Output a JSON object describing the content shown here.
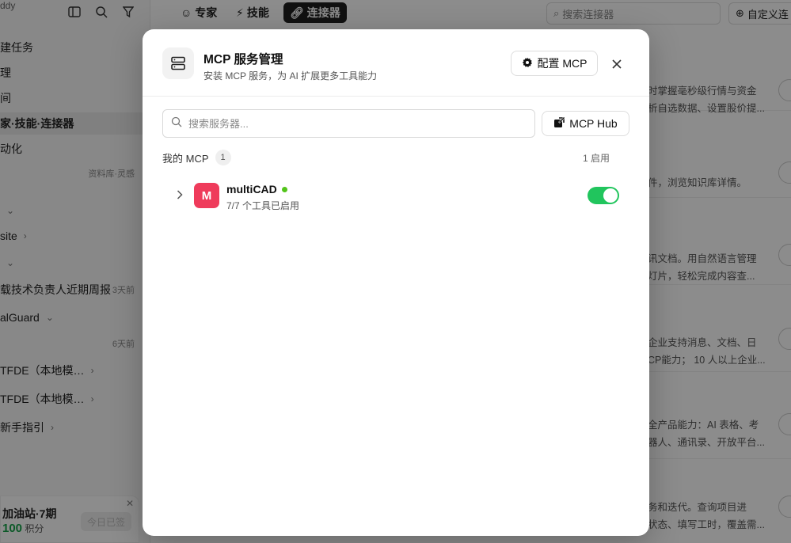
{
  "app": {
    "brand": "ddy",
    "sidebar": {
      "items": [
        {
          "label": "建任务",
          "meta": ""
        },
        {
          "label": "理",
          "meta": ""
        },
        {
          "label": "间",
          "meta": ""
        },
        {
          "label": "家·技能·连接器",
          "meta": ""
        },
        {
          "label": "动化",
          "meta": ""
        },
        {
          "label": "",
          "meta": "资料库·灵感"
        },
        {
          "label": "",
          "meta": ""
        },
        {
          "label": "site",
          "meta": ""
        },
        {
          "label": "",
          "meta": ""
        },
        {
          "label": "载技术负责人近期周报",
          "meta": "3天前"
        },
        {
          "label": "alGuard",
          "meta": ""
        },
        {
          "label": "",
          "meta": "6天前"
        },
        {
          "label": "TFDE（本地模…",
          "meta": ""
        },
        {
          "label": "TFDE（本地模…",
          "meta": ""
        },
        {
          "label": "新手指引",
          "meta": ""
        }
      ],
      "promo": {
        "title": "加油站·7期",
        "points_value": "100",
        "points_unit": "积分",
        "button": "今日已签"
      }
    },
    "topbar": {
      "tabs": [
        "专家",
        "技能",
        "连接器"
      ],
      "search_placeholder": "搜索连接器",
      "custom_button": "自定义连"
    },
    "cards": [
      {
        "line1": "时掌握毫秒级行情与资金",
        "line2": "析自选数据、设置股价提..."
      },
      {
        "line1": "",
        "line2": "件，浏览知识库详情。"
      },
      {
        "line1": "讯文档。用自然语言管理",
        "line2": "灯片，轻松完成内容查..."
      },
      {
        "line1": "企业支持消息、文档、日",
        "line2": "CP能力； 10 人以上企业..."
      },
      {
        "line1": "全产品能力：AI 表格、考",
        "line2": "器人、通讯录、开放平台..."
      },
      {
        "line1": "务和迭代。查询项目进",
        "line2": "状态、填写工时，覆盖需..."
      }
    ]
  },
  "modal": {
    "title": "MCP 服务管理",
    "subtitle": "安装 MCP 服务，为 AI 扩展更多工具能力",
    "config_button": "配置 MCP",
    "search_placeholder": "搜索服务器...",
    "hub_button": "MCP Hub",
    "section_label": "我的 MCP",
    "section_count": "1",
    "enabled_summary": "1 启用",
    "servers": [
      {
        "avatar_letter": "M",
        "name": "multiCAD",
        "status": "online",
        "tools_text": "7/7 个工具已启用",
        "enabled": true
      }
    ]
  },
  "colors": {
    "accent_green": "#21c55d",
    "status_dot": "#52c41a",
    "avatar_bg": "#ef3b5b",
    "overlay": "rgba(0,0,0,0.45)"
  }
}
